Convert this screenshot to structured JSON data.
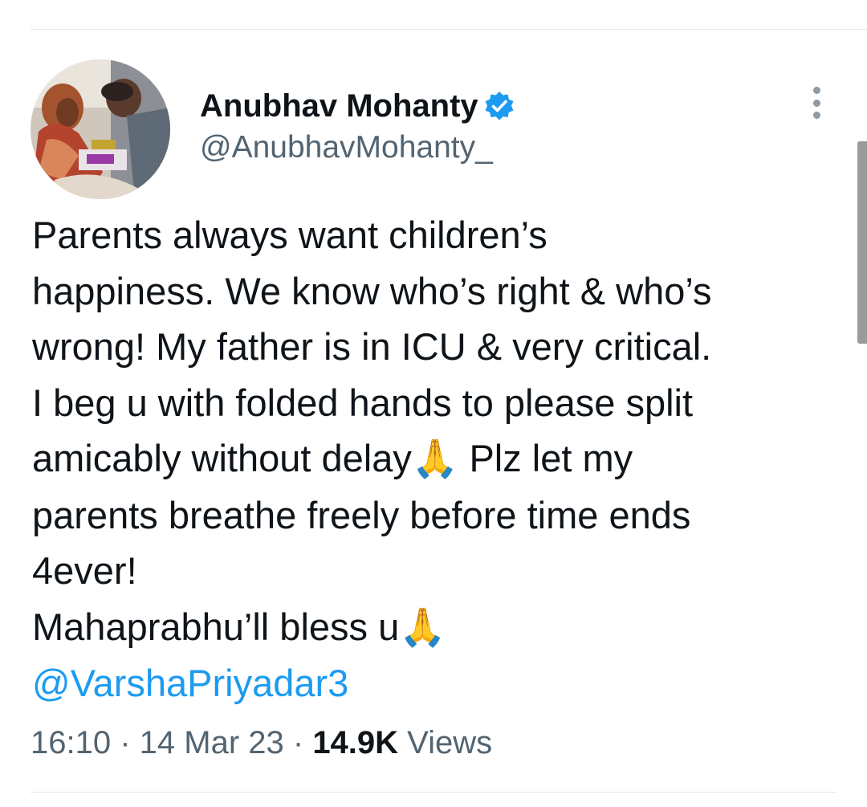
{
  "author": {
    "display_name": "Anubhav Mohanty",
    "handle": "@AnubhavMohanty_",
    "verified": true,
    "verified_color": "#1d9bf0"
  },
  "tweet": {
    "lines": [
      "Parents always want children’s",
      "happiness. We know who’s right & who’s",
      "wrong! My father is in ICU & very critical.",
      "I beg u with folded hands to please split",
      "amicably without delay",
      " Plz let my",
      "parents breathe freely before time ends",
      "4ever!",
      "Mahaprabhu’ll bless u"
    ],
    "emoji": "🙏",
    "mention": "@VarshaPriyadar3",
    "mention_color": "#1d9bf0"
  },
  "meta": {
    "time": "16:10",
    "separator": " · ",
    "date": "14 Mar 23",
    "views_count": "14.9K",
    "views_label": " Views"
  },
  "icons": {
    "verified": "verified-badge-icon",
    "more": "more-vertical-icon"
  }
}
